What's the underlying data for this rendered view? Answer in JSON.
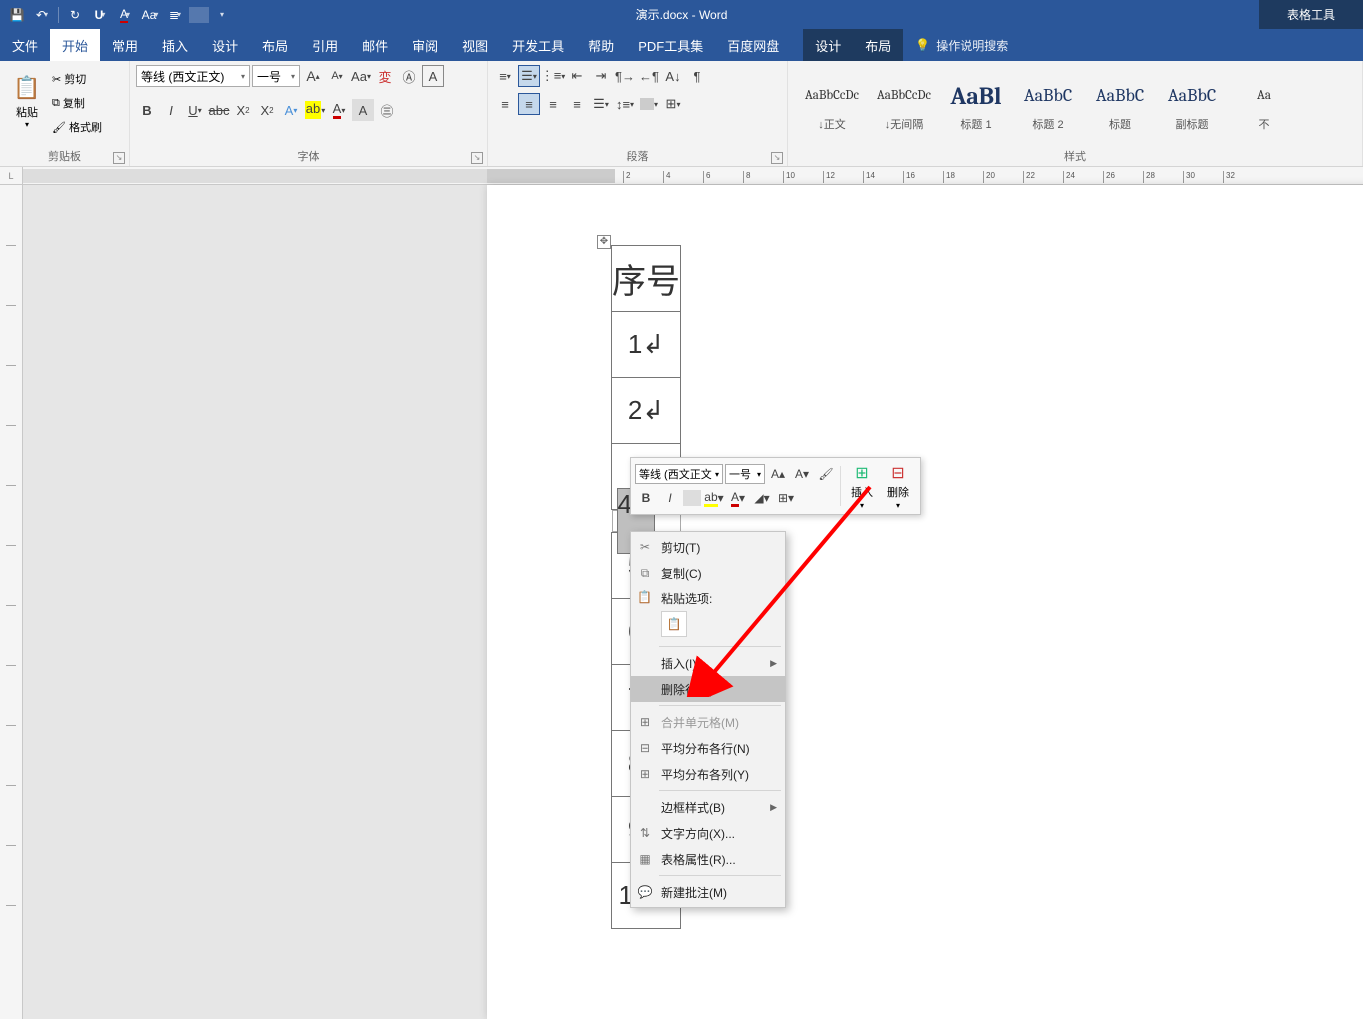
{
  "app": {
    "title": "演示.docx - Word",
    "contextual_tool": "表格工具"
  },
  "qat": {
    "items": [
      "save-icon",
      "undo-icon",
      "redo-icon",
      "underline-icon",
      "font-color-icon",
      "case-icon",
      "list-icon",
      "shade-icon",
      "more-icon"
    ]
  },
  "tabs": {
    "items": [
      "文件",
      "开始",
      "常用",
      "插入",
      "设计",
      "布局",
      "引用",
      "邮件",
      "审阅",
      "视图",
      "开发工具",
      "帮助",
      "PDF工具集",
      "百度网盘"
    ],
    "active": "开始",
    "contextual": [
      "设计",
      "布局"
    ],
    "tell_me": "操作说明搜索"
  },
  "ribbon": {
    "clipboard": {
      "label": "剪贴板",
      "paste": "粘贴",
      "cut": "剪切",
      "copy": "复制",
      "format_painter": "格式刷"
    },
    "font": {
      "label": "字体",
      "family": "等线 (西文正文)",
      "size": "一号"
    },
    "paragraph": {
      "label": "段落"
    },
    "styles": {
      "label": "样式",
      "items": [
        {
          "preview": "AaBbCcDc",
          "name": "↓正文",
          "cls": ""
        },
        {
          "preview": "AaBbCcDc",
          "name": "↓无间隔",
          "cls": ""
        },
        {
          "preview": "AaBl",
          "name": "标题 1",
          "cls": "h1"
        },
        {
          "preview": "AaBbC",
          "name": "标题 2",
          "cls": "h"
        },
        {
          "preview": "AaBbC",
          "name": "标题",
          "cls": "h"
        },
        {
          "preview": "AaBbC",
          "name": "副标题",
          "cls": "h"
        },
        {
          "preview": "Aa",
          "name": "不",
          "cls": ""
        }
      ]
    }
  },
  "table": {
    "header": "序号",
    "rows": [
      "1↲",
      "2↲",
      "",
      "4↲",
      "5↲",
      "6↲",
      "7↲",
      "8↲",
      "9↲",
      "10→"
    ],
    "selected_index": 4
  },
  "mini_toolbar": {
    "font": "等线 (西文正文",
    "size": "一号",
    "insert": "插入",
    "delete": "删除"
  },
  "context_menu": {
    "cut": "剪切(T)",
    "copy": "复制(C)",
    "paste_label": "粘贴选项:",
    "insert": "插入(I)",
    "delete_row": "删除行(D)",
    "merge": "合并单元格(M)",
    "dist_rows": "平均分布各行(N)",
    "dist_cols": "平均分布各列(Y)",
    "border_style": "边框样式(B)",
    "text_dir": "文字方向(X)...",
    "table_props": "表格属性(R)...",
    "new_comment": "新建批注(M)"
  },
  "colors": {
    "ribbon_blue": "#2b579a",
    "ctx_blue": "#1e3a5f",
    "arrow_red": "#ff0000",
    "highlight_yellow": "#ffff00",
    "font_red": "#c00000"
  }
}
